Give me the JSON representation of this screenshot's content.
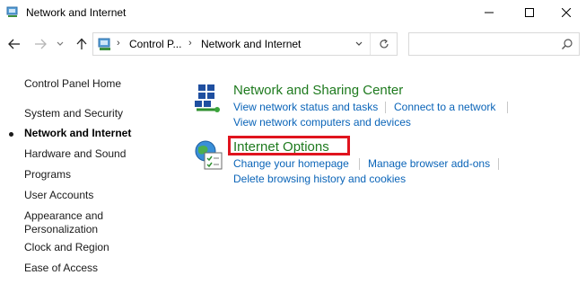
{
  "window": {
    "title": "Network and Internet",
    "controls": [
      "minimize",
      "maximize",
      "close"
    ]
  },
  "address_bar": {
    "breadcrumbs": [
      "Control P...",
      "Network and Internet"
    ],
    "icon": "control-panel-icon"
  },
  "search": {
    "placeholder": "",
    "value": ""
  },
  "sidebar": {
    "items": [
      {
        "label": "Control Panel Home",
        "active": false
      },
      {
        "label": "System and Security",
        "active": false
      },
      {
        "label": "Network and Internet",
        "active": true
      },
      {
        "label": "Hardware and Sound",
        "active": false
      },
      {
        "label": "Programs",
        "active": false
      },
      {
        "label": "User Accounts",
        "active": false
      },
      {
        "label": "Appearance and",
        "label2": "Personalization",
        "active": false
      },
      {
        "label": "Clock and Region",
        "active": false
      },
      {
        "label": "Ease of Access",
        "active": false
      }
    ]
  },
  "categories": [
    {
      "title": "Network and Sharing Center",
      "icon": "network-sharing-icon",
      "links": [
        "View network status and tasks",
        "Connect to a network",
        "View network computers and devices"
      ]
    },
    {
      "title": "Internet Options",
      "icon": "internet-options-icon",
      "links": [
        "Change your homepage",
        "Manage browser add-ons",
        "Delete browsing history and cookies"
      ],
      "highlighted": true
    }
  ],
  "colors": {
    "category_title": "#1e7a1e",
    "link": "#0a64b8",
    "highlight": "#e0141e"
  }
}
